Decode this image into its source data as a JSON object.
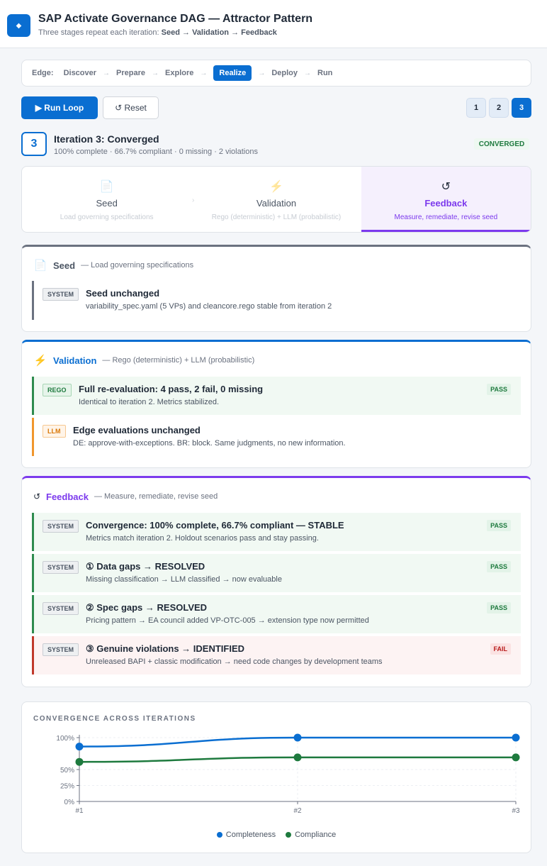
{
  "header": {
    "logo_glyph": "◆",
    "title": "SAP Activate Governance DAG — Attractor Pattern",
    "subtitle_prefix": "Three stages repeat each iteration: ",
    "subtitle_flow": "Seed → Validation → Feedback"
  },
  "edges": {
    "label": "Edge:",
    "items": [
      "Discover",
      "Prepare",
      "Explore",
      "Realize",
      "Deploy",
      "Run"
    ],
    "active": "Realize"
  },
  "controls": {
    "run_label": "▶ Run Loop",
    "reset_label": "↺ Reset",
    "iterations": [
      "1",
      "2",
      "3"
    ],
    "active_iteration": "3"
  },
  "iteration": {
    "number": "3",
    "title": "Iteration 3: Converged",
    "summary": "100% complete · 66.7% compliant · 0 missing · 2 violations",
    "badge": "CONVERGED"
  },
  "stages": [
    {
      "icon": "📄",
      "icon_name": "document-icon",
      "name": "Seed",
      "desc": "Load governing specifications"
    },
    {
      "icon": "⚡",
      "icon_name": "lightning-icon",
      "name": "Validation",
      "desc": "Rego (deterministic) + LLM (probabilistic)"
    },
    {
      "icon": "↺",
      "icon_name": "cycle-icon",
      "name": "Feedback",
      "desc": "Measure, remediate, revise seed"
    }
  ],
  "seed_panel": {
    "icon": "📄",
    "name": "Seed",
    "desc": "— Load governing specifications",
    "color": "#6b7280",
    "entries": [
      {
        "tag": "SYSTEM",
        "title": "Seed unchanged",
        "desc": "variability_spec.yaml (5 VPs) and cleancore.rego stable from iteration 2"
      }
    ]
  },
  "validation_panel": {
    "icon": "⚡",
    "name": "Validation",
    "desc": "— Rego (deterministic) + LLM (probabilistic)",
    "color": "#0a6ed1",
    "entries": [
      {
        "tag": "REGO",
        "title": "Full re-evaluation: 4 pass, 2 fail, 0 missing",
        "desc": "Identical to iteration 2. Metrics stabilized.",
        "status": "PASS"
      },
      {
        "tag": "LLM",
        "title": "Edge evaluations unchanged",
        "desc": "DE: approve-with-exceptions. BR: block. Same judgments, no new information."
      }
    ]
  },
  "feedback_panel": {
    "icon": "↺",
    "name": "Feedback",
    "desc": "— Measure, remediate, revise seed",
    "color": "#7c3aed",
    "entries": [
      {
        "tag": "SYSTEM",
        "title": "Convergence: 100% complete, 66.7% compliant — STABLE",
        "desc": "Metrics match iteration 2. Holdout scenarios pass and stay passing.",
        "status": "PASS"
      },
      {
        "tag": "SYSTEM",
        "title": "① Data gaps → RESOLVED",
        "desc": "Missing classification → LLM classified → now evaluable",
        "status": "PASS"
      },
      {
        "tag": "SYSTEM",
        "title": "② Spec gaps → RESOLVED",
        "desc": "Pricing pattern → EA council added VP-OTC-005 → extension type now permitted",
        "status": "PASS"
      },
      {
        "tag": "SYSTEM",
        "title": "③ Genuine violations → IDENTIFIED",
        "desc": "Unreleased BAPI + classic modification → need code changes by development teams",
        "status": "FAIL"
      }
    ]
  },
  "chart_data": {
    "type": "line",
    "title": "CONVERGENCE ACROSS ITERATIONS",
    "categories": [
      "#1",
      "#2",
      "#3"
    ],
    "series": [
      {
        "name": "Completeness",
        "values": [
          86,
          100,
          100
        ],
        "color": "#0a6ed1"
      },
      {
        "name": "Compliance",
        "values": [
          62,
          69,
          69
        ],
        "color": "#1e7a3e"
      }
    ],
    "y_ticks": [
      "0%",
      "25%",
      "50%",
      "100%"
    ],
    "y_tick_values": [
      0,
      25,
      50,
      100
    ],
    "ylim": [
      0,
      100
    ],
    "legend": "bottom-center",
    "grid": true
  }
}
